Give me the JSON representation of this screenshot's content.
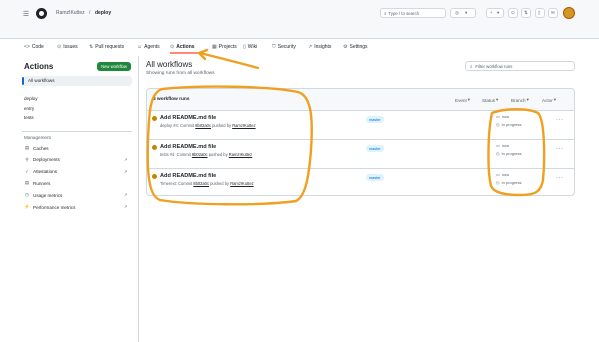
{
  "header": {
    "owner": "RamzIKuttez",
    "separator": "/",
    "repo": "deploy",
    "search_placeholder": "Type / to search",
    "avatar_color": "#d29922"
  },
  "repo_nav": {
    "items": [
      {
        "icon": "code-icon",
        "glyph": "<>",
        "label": "Code"
      },
      {
        "icon": "issue-icon",
        "glyph": "⊙",
        "label": "Issues"
      },
      {
        "icon": "pull-request-icon",
        "glyph": "⇅",
        "label": "Pull requests"
      },
      {
        "icon": "agents-icon",
        "glyph": "☺",
        "label": "Agents"
      },
      {
        "icon": "actions-icon",
        "glyph": "⊙",
        "label": "Actions"
      },
      {
        "icon": "projects-icon",
        "glyph": "▦",
        "label": "Projects"
      },
      {
        "icon": "wiki-icon",
        "glyph": "▯",
        "label": "Wiki"
      },
      {
        "icon": "security-icon",
        "glyph": "⛉",
        "label": "Security"
      },
      {
        "icon": "insights-icon",
        "glyph": "↗",
        "label": "Insights"
      },
      {
        "icon": "settings-icon",
        "glyph": "⚙",
        "label": "Settings"
      }
    ],
    "active_index": 4
  },
  "sidebar": {
    "title": "Actions",
    "new_workflow_label": "New workflow",
    "all_workflows_label": "All workflows",
    "workflows": [
      "deploy",
      "entry",
      "tests"
    ],
    "management_heading": "Management",
    "management_items": [
      {
        "icon": "caches-icon",
        "glyph": "▤",
        "label": "Caches",
        "external": false
      },
      {
        "icon": "deployments-icon",
        "glyph": "⚲",
        "label": "Deployments",
        "external": true
      },
      {
        "icon": "attestations-icon",
        "glyph": "✓",
        "label": "Attestations",
        "external": true
      },
      {
        "icon": "runners-icon",
        "glyph": "▤",
        "label": "Runners",
        "external": false
      },
      {
        "icon": "usage-metrics-icon",
        "glyph": "◷",
        "label": "Usage metrics",
        "external": true
      },
      {
        "icon": "performance-metrics-icon",
        "glyph": "⚡",
        "label": "Performance metrics",
        "external": true
      }
    ],
    "external_glyph": "↗"
  },
  "main": {
    "title": "All workflows",
    "subtitle": "Showing runs from all workflows",
    "filter_placeholder": "Filter workflow runs",
    "runs_count_label": "3 workflow runs",
    "filters": [
      {
        "label": "Event",
        "caret": "▾"
      },
      {
        "label": "Status",
        "caret": "▾"
      },
      {
        "label": "Branch",
        "caret": "▾"
      },
      {
        "label": "Actor",
        "caret": "▾"
      }
    ],
    "runs": [
      {
        "title": "Add README.md file",
        "sub_prefix": "deploy #4: Commit",
        "commit": "8b02a0c",
        "sub_mid": "pushed by",
        "user": "RamzIKuttez",
        "branch": "master",
        "time": "now",
        "duration": "In progress",
        "menu": "···"
      },
      {
        "title": "Add README.md file",
        "sub_prefix": "tests #4: Commit",
        "commit": "8b02a0c",
        "sub_mid": "pushed by",
        "user": "RamzIKuttez",
        "branch": "master",
        "time": "now",
        "duration": "In progress",
        "menu": "···"
      },
      {
        "title": "Add README.md file",
        "sub_prefix": "Timerext: Commit",
        "commit": "8b02a0c",
        "sub_mid": "pushed by",
        "user": "RamzIKuttez",
        "branch": "master",
        "time": "now",
        "duration": "In progress",
        "menu": "···"
      }
    ]
  },
  "colors": {
    "annotation": "#f0a020",
    "run_status": "#bf8700",
    "new_workflow_bg": "#1f883d",
    "active_tab_underline": "#fd8c73",
    "branch_badge_bg": "#ddf4ff",
    "branch_badge_text": "#0969da"
  }
}
